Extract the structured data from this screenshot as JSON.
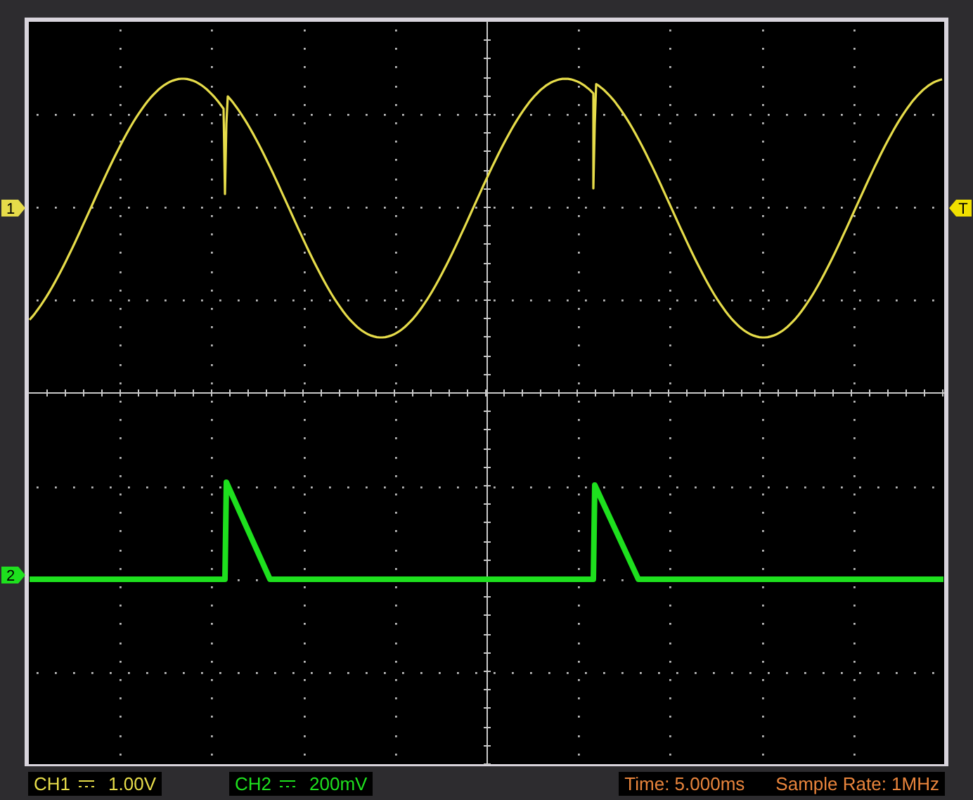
{
  "channels": [
    {
      "marker": "1",
      "name": "CH1",
      "scale": "1.00V",
      "color": "#e6dc4a"
    },
    {
      "marker": "2",
      "name": "CH2",
      "scale": "200mV",
      "color": "#1ee01e"
    }
  ],
  "trigger": {
    "marker": "T"
  },
  "status": {
    "time": "Time: 5.000ms",
    "sample_rate": "Sample Rate: 1MHz"
  }
}
